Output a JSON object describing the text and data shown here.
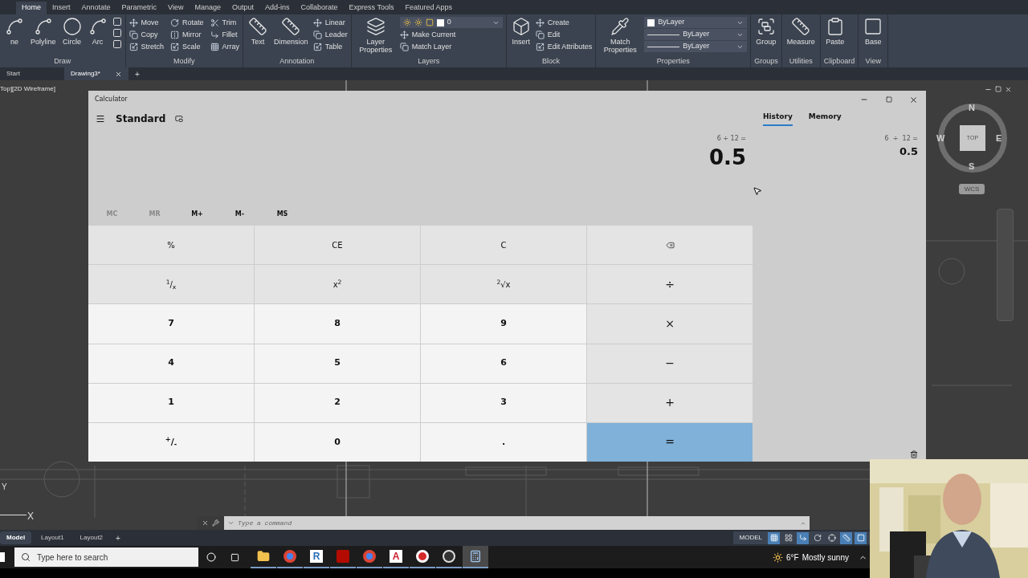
{
  "ribbon_tabs": [
    {
      "label": "Home",
      "selected": true
    },
    {
      "label": "Insert",
      "selected": false
    },
    {
      "label": "Annotate",
      "selected": false
    },
    {
      "label": "Parametric",
      "selected": false
    },
    {
      "label": "View",
      "selected": false
    },
    {
      "label": "Manage",
      "selected": false
    },
    {
      "label": "Output",
      "selected": false
    },
    {
      "label": "Add-ins",
      "selected": false
    },
    {
      "label": "Collaborate",
      "selected": false
    },
    {
      "label": "Express Tools",
      "selected": false
    },
    {
      "label": "Featured Apps",
      "selected": false
    }
  ],
  "ribbon_panels": [
    {
      "title": "Draw",
      "large": [
        "ne",
        "Polyline",
        "Circle",
        "Arc"
      ]
    },
    {
      "title": "Modify",
      "small": [
        "Move",
        "Copy",
        "Stretch",
        "Rotate",
        "Mirror",
        "Scale",
        "Trim",
        "Fillet",
        "Array"
      ]
    },
    {
      "title": "Annotation",
      "large": [
        "Text",
        "Dimension"
      ],
      "small": [
        "Linear",
        "Leader",
        "Table"
      ]
    },
    {
      "title": "Layers",
      "large": [
        "Layer Properties"
      ],
      "dropdowns": [
        {
          "kind": "layer",
          "value": "0"
        }
      ],
      "small": [
        "Make Current",
        "Match Layer"
      ]
    },
    {
      "title": "Block",
      "large": [
        "Insert"
      ],
      "small": [
        "Create",
        "Edit",
        "Edit Attributes"
      ]
    },
    {
      "title": "Properties",
      "large": [
        "Match Properties"
      ],
      "dropdowns": [
        {
          "kind": "color",
          "value": "ByLayer"
        },
        {
          "kind": "line",
          "value": "ByLayer"
        },
        {
          "kind": "line",
          "value": "ByLayer"
        }
      ]
    },
    {
      "title": "Groups",
      "large": [
        "Group"
      ]
    },
    {
      "title": "Utilities",
      "large": [
        "Measure"
      ]
    },
    {
      "title": "Clipboard",
      "large": [
        "Paste"
      ]
    },
    {
      "title": "View",
      "large": [
        "Base"
      ]
    }
  ],
  "file_tabs": [
    {
      "label": "Start",
      "selected": false
    },
    {
      "label": "Drawing3*",
      "selected": true
    }
  ],
  "new_tab": "+",
  "viewport_label": "Top][2D Wireframe]",
  "viewcube": {
    "north": "N",
    "west": "W",
    "east": "E",
    "south": "S",
    "face": "TOP",
    "coords": "WCS"
  },
  "ucs": {
    "y": "Y",
    "x": "X"
  },
  "calculator": {
    "title": "Calculator",
    "mode": "Standard",
    "expression": "6 ÷ 12 =",
    "result": "0.5",
    "memory_buttons": [
      {
        "label": "MC",
        "disabled": true
      },
      {
        "label": "MR",
        "disabled": true
      },
      {
        "label": "M+",
        "disabled": false
      },
      {
        "label": "M-",
        "disabled": false
      },
      {
        "label": "MS",
        "disabled": false
      }
    ],
    "keys": [
      {
        "kind": "func",
        "label": "%"
      },
      {
        "kind": "func",
        "label": "CE"
      },
      {
        "kind": "func",
        "label": "C"
      },
      {
        "kind": "backspace"
      },
      {
        "kind": "func",
        "label": "$^{1}$/$_{x}$"
      },
      {
        "kind": "func",
        "label": "x$^{2}$"
      },
      {
        "kind": "func",
        "label": "$^{2}$√x"
      },
      {
        "kind": "op",
        "label": "÷"
      },
      {
        "kind": "digit",
        "label": "7"
      },
      {
        "kind": "digit",
        "label": "8"
      },
      {
        "kind": "digit",
        "label": "9"
      },
      {
        "kind": "op",
        "label": "×"
      },
      {
        "kind": "digit",
        "label": "4"
      },
      {
        "kind": "digit",
        "label": "5"
      },
      {
        "kind": "digit",
        "label": "6"
      },
      {
        "kind": "op",
        "label": "−"
      },
      {
        "kind": "digit",
        "label": "1"
      },
      {
        "kind": "digit",
        "label": "2"
      },
      {
        "kind": "digit",
        "label": "3"
      },
      {
        "kind": "op",
        "label": "+"
      },
      {
        "kind": "digit",
        "label": "$^{+}$/$_{-}$"
      },
      {
        "kind": "digit",
        "label": "0"
      },
      {
        "kind": "digit",
        "label": "."
      },
      {
        "kind": "equals",
        "label": "="
      }
    ],
    "panel_tabs": [
      {
        "label": "History",
        "selected": true
      },
      {
        "label": "Memory",
        "selected": false
      }
    ],
    "history": [
      {
        "expression": "6  ÷  12 =",
        "result": "0.5"
      }
    ]
  },
  "command_line": {
    "placeholder": "Type a command"
  },
  "layout_tabs": [
    {
      "label": "Model",
      "selected": true
    },
    {
      "label": "Layout1",
      "selected": false
    },
    {
      "label": "Layout2",
      "selected": false
    }
  ],
  "add_layout": "+",
  "status_bar": {
    "space": "MODEL",
    "toggles": [
      {
        "kind": "grid",
        "on": true
      },
      {
        "kind": "snap",
        "on": false
      },
      {
        "kind": "ortho",
        "on": true
      },
      {
        "kind": "polar",
        "on": false
      },
      {
        "kind": "osnap",
        "on": false
      },
      {
        "kind": "angle",
        "on": true
      },
      {
        "kind": "select",
        "on": true
      }
    ]
  },
  "taskbar": {
    "search_placeholder": "Type here to search",
    "apps": [
      {
        "kind": "folder",
        "selected": false
      },
      {
        "kind": "browser",
        "selected": false
      },
      {
        "kind": "letter",
        "glyph": "R",
        "color": "#2a6db5",
        "selected": false
      },
      {
        "kind": "pdf",
        "selected": false
      },
      {
        "kind": "browser",
        "selected": false
      },
      {
        "kind": "letter",
        "glyph": "A",
        "color": "#c8202f",
        "selected": false
      },
      {
        "kind": "ring",
        "selected": false
      },
      {
        "kind": "obs",
        "selected": false
      },
      {
        "kind": "calculator",
        "selected": true
      }
    ],
    "temperature": "6°F",
    "weather": "Mostly sunny"
  }
}
